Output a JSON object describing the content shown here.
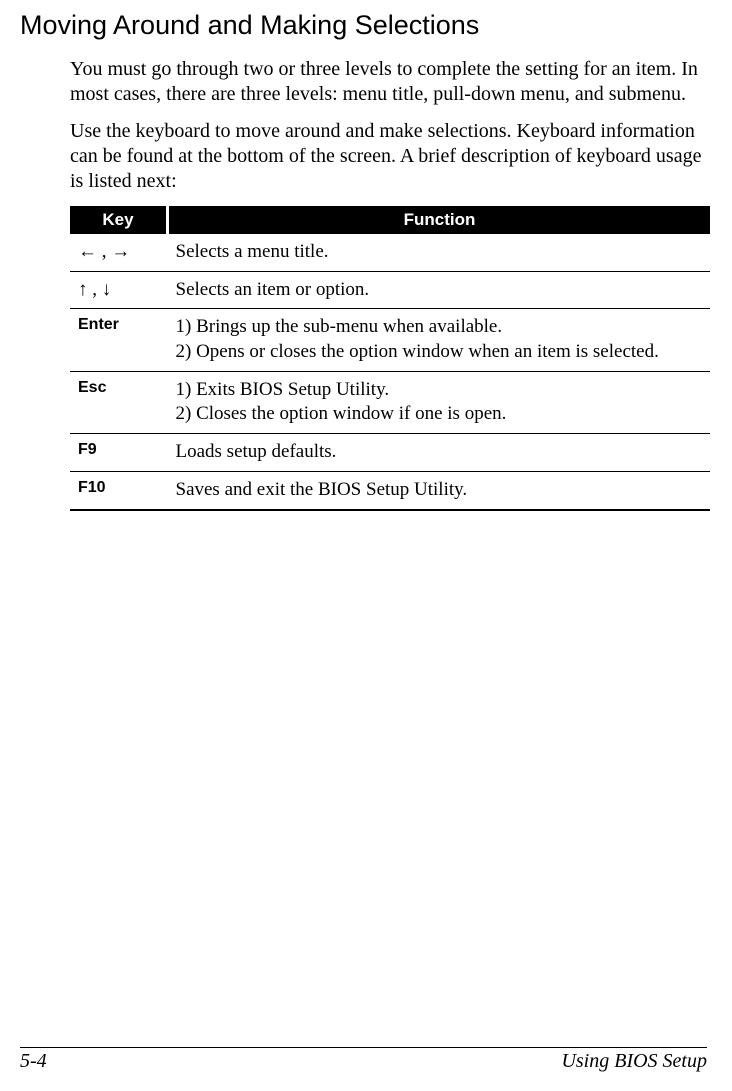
{
  "heading": "Moving Around and Making Selections",
  "para1": "You must go through two or three levels to complete the setting for an item. In most cases, there are three levels: menu title, pull-down menu, and submenu.",
  "para2": "Use the keyboard to move around and make selections. Keyboard information can be found at the bottom of the screen. A brief description of keyboard usage is listed next:",
  "table": {
    "headers": {
      "key": "Key",
      "function": "Function"
    },
    "rows": [
      {
        "key": "← , →",
        "arrows": true,
        "function": "Selects a menu title."
      },
      {
        "key": "↑ , ↓",
        "arrows": true,
        "function": "Selects an item or option."
      },
      {
        "key": "Enter",
        "arrows": false,
        "function": "1) Brings up the sub-menu when available.\n2) Opens or closes the option window when an item is selected."
      },
      {
        "key": "Esc",
        "arrows": false,
        "function": "1) Exits BIOS Setup Utility.\n2) Closes the option window if one is open."
      },
      {
        "key": "F9",
        "arrows": false,
        "function": "Loads setup defaults."
      },
      {
        "key": "F10",
        "arrows": false,
        "function": "Saves and exit the BIOS Setup Utility."
      }
    ]
  },
  "footer": {
    "left": "5-4",
    "right": "Using BIOS Setup"
  }
}
